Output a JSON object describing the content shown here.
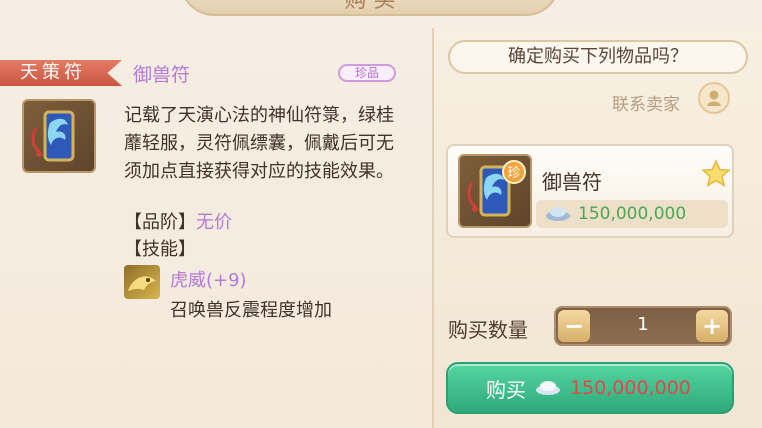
{
  "header": {
    "title": "购 买"
  },
  "left": {
    "category_tag": "天策符",
    "item_name": "御兽符",
    "rarity_label": "珍品",
    "description": "记载了天演心法的神仙符箓，绿桂蘼轻服，灵符佩缥囊，佩戴后可无须加点直接获得对应的技能效果。",
    "grade_label": "【品阶】",
    "grade_value": "无价",
    "skill_header": "【技能】",
    "skill_name": "虎威(+9)",
    "skill_desc": "召唤兽反震程度增加"
  },
  "right": {
    "confirm_text": "确定购买下列物品吗？",
    "contact_seller": "联系卖家",
    "card_title": "御兽符",
    "card_badge": "珍",
    "card_price": "150,000,000",
    "qty_label": "购买数量",
    "qty_value": "1",
    "buy_label": "购买",
    "buy_price": "150,000,000"
  },
  "colors": {
    "rare_purple": "#b47ad6",
    "price_green": "#47a856",
    "buy_green": "#30a97b",
    "buy_price_red": "#e2474b"
  },
  "icons": {
    "item": "talisman-icon",
    "skill": "tiger-skill-icon",
    "silver": "silver-ingot-icon",
    "star": "star-icon",
    "contact": "person-icon"
  }
}
